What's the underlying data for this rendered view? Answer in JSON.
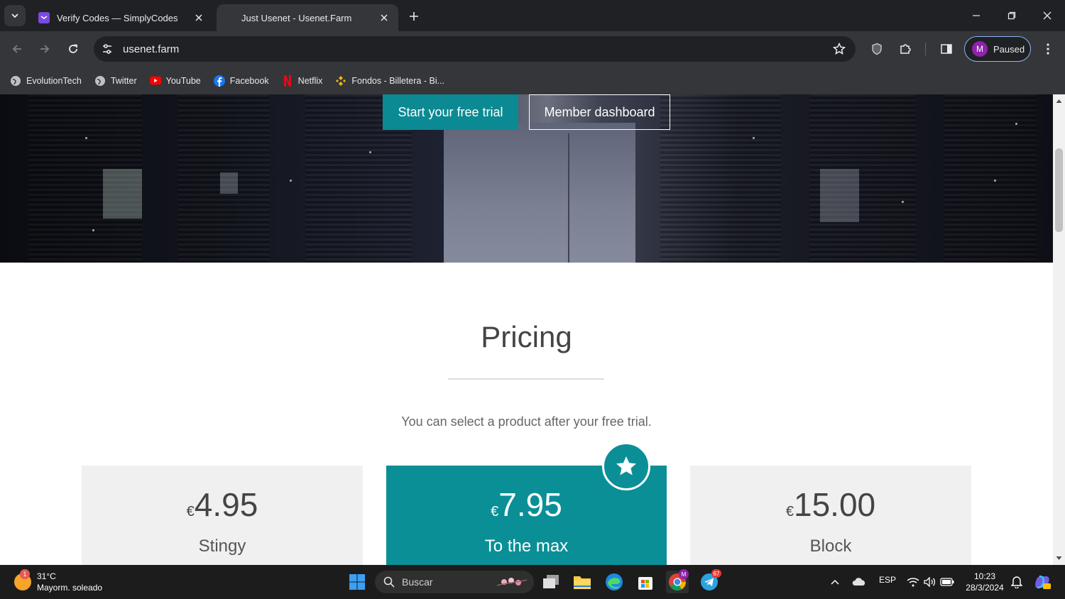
{
  "browser": {
    "tabs": [
      {
        "title": "Verify Codes — SimplyCodes",
        "favicon": "simplycodes-icon",
        "active": false
      },
      {
        "title": "Just Usenet - Usenet.Farm",
        "favicon": "",
        "active": true
      }
    ],
    "url": "usenet.farm",
    "profile": {
      "initial": "M",
      "status": "Paused"
    },
    "bookmarks": [
      {
        "label": "EvolutionTech",
        "icon": "globe-icon"
      },
      {
        "label": "Twitter",
        "icon": "globe-icon"
      },
      {
        "label": "YouTube",
        "icon": "youtube-icon"
      },
      {
        "label": "Facebook",
        "icon": "facebook-icon"
      },
      {
        "label": "Netflix",
        "icon": "netflix-icon"
      },
      {
        "label": "Fondos - Billetera - Bi...",
        "icon": "binance-icon"
      }
    ]
  },
  "page": {
    "hero": {
      "trial_button": "Start your free trial",
      "dashboard_button": "Member dashboard"
    },
    "pricing": {
      "title": "Pricing",
      "subtitle": "You can select a product after your free trial.",
      "plans": [
        {
          "currency": "€",
          "price": "4.95",
          "name": "Stingy",
          "featured": false
        },
        {
          "currency": "€",
          "price": "7.95",
          "name": "To the max",
          "featured": true
        },
        {
          "currency": "€",
          "price": "15.00",
          "name": "Block",
          "featured": false
        }
      ]
    }
  },
  "colors": {
    "accent": "#0a8f97",
    "card_bg": "#f0f0f0"
  },
  "taskbar": {
    "weather": {
      "temp": "31°C",
      "desc": "Mayorm. soleado",
      "badge": "1"
    },
    "search_label": "Buscar",
    "language": "ESP",
    "time": "10:23",
    "date": "28/3/2024",
    "telegram_badge": "67",
    "chrome_badge": "M"
  }
}
